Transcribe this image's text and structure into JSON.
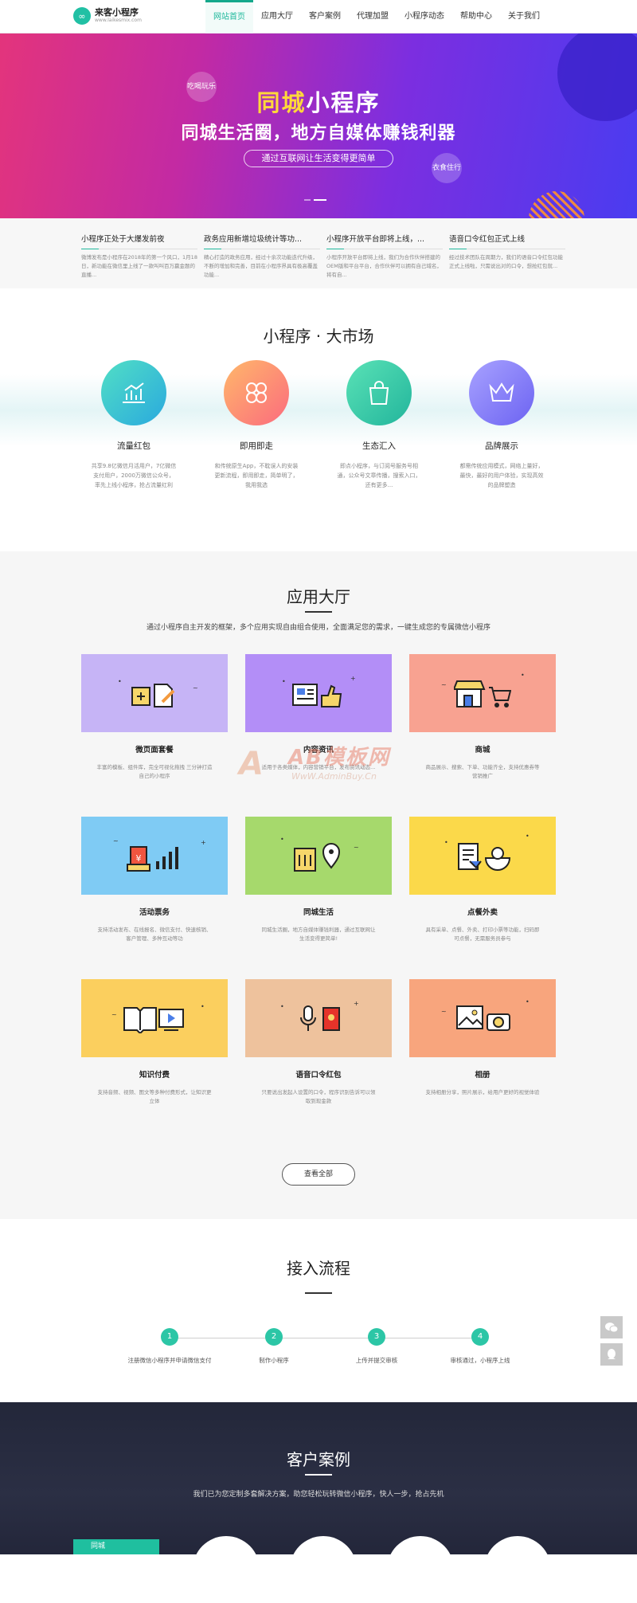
{
  "header": {
    "logo_name": "来客小程序",
    "logo_url": "www.laikesmix.com",
    "nav": [
      "网站首页",
      "应用大厅",
      "客户案例",
      "代理加盟",
      "小程序动态",
      "帮助中心",
      "关于我们"
    ]
  },
  "banner": {
    "title_hl": "同城",
    "title_rest": "小程序",
    "subtitle": "同城生活圈，地方自媒体赚钱利器",
    "pill": "通过互联网让生活变得更简单",
    "bubble_left": "吃喝玩乐",
    "bubble_right": "衣食住行"
  },
  "news": [
    {
      "title": "小程序正处于大爆发前夜",
      "text": "微博发布是小程序在2018年的第一个风口，1月18日，新功能在微信里上线了一款叫叫百万赢金题的直播..."
    },
    {
      "title": "政务应用新增垃圾统计等功...",
      "text": "精心打造的政务应用，经过十余次功能迭代升级，不断的增加和完善，目前在小程序界具有极高覆盖功能..."
    },
    {
      "title": "小程序开放平台即将上线，...",
      "text": "小程序开放平台即将上线，我们为合作伙伴搭建的OEM版和平台平台，合作伙伴可以拥有自己域名，将有自..."
    },
    {
      "title": "语音口令红包正式上线",
      "text": "经过技术团队在周期力，我们的语音口令红包功能正式上线啦，只需说出对的口令，想抢红包就..."
    }
  ],
  "market": {
    "title": "小程序 · 大市场",
    "items": [
      {
        "title": "流量红包",
        "text": "共享9.8亿微信月活用户，7亿微信支付用户，2000万微信公众号，率先上线小程序，抢占流量红利"
      },
      {
        "title": "即用即走",
        "text": "和传统原生App，不耽误人的安装更新流程，即用即走，简单明了，我用我选"
      },
      {
        "title": "生态汇入",
        "text": "即点小程序，与订阅号服务号相通，公众号文章传播，搜索入口，还有更多..."
      },
      {
        "title": "品牌展示",
        "text": "都需传统应用模式，网络上量好，最快，最好的用户体验，实现高效的品牌塑造"
      }
    ]
  },
  "apps": {
    "title": "应用大厅",
    "desc": "通过小程序自主开发的框架，多个应用实现自由组合使用，全面满足您的需求，一键生成您的专属微信小程序",
    "items": [
      {
        "title": "微页面套餐",
        "text": "丰富的模板、组件库，完全可视化拖拽 三分钟打造自己的小程序",
        "color": "#c6b4f6"
      },
      {
        "title": "内容资讯",
        "text": "适用于各类媒体，内容营销平台，发布资讯动态...",
        "color": "#b38ef7"
      },
      {
        "title": "商城",
        "text": "商品展示、搜索、下单、功能齐全，支持优惠券等营销推广",
        "color": "#f8a291"
      },
      {
        "title": "活动票务",
        "text": "支持活动发布、在线报名、微信支付、快速核销、客户管理、多种互动等功",
        "color": "#7fcbf4"
      },
      {
        "title": "同城生活",
        "text": "同城生活圈，地方自媒体赚钱利器，通过互联网让生活变得更简单!",
        "color": "#a6d96c"
      },
      {
        "title": "点餐外卖",
        "text": "具有采单、点餐、外卖、打印小票等功能，扫码即可点餐，无需服务员参与",
        "color": "#fbd94a"
      },
      {
        "title": "知识付费",
        "text": "支持音频、视频、图文等多种付费形式，让知识更立体",
        "color": "#fbcf5e"
      },
      {
        "title": "语音口令红包",
        "text": "只要说出发起人设置的口令，程序识别告诉可以领取到现金款",
        "color": "#eec29d"
      },
      {
        "title": "相册",
        "text": "支持相册分享，照片展示，给用户更好的视觉体验",
        "color": "#f8a57d"
      }
    ],
    "view_all": "查看全部"
  },
  "watermark": {
    "big": "AB模板网",
    "small": "WwW.AdminBuy.Cn"
  },
  "process": {
    "title": "接入流程",
    "steps": [
      {
        "num": "1",
        "label": "注册微信小程序并申请微信支付"
      },
      {
        "num": "2",
        "label": "制作小程序"
      },
      {
        "num": "3",
        "label": "上传并提交审核"
      },
      {
        "num": "4",
        "label": "审核通过，小程序上线"
      }
    ]
  },
  "cases": {
    "title": "客户案例",
    "desc": "我们已为您定制多套解决方案，助您轻松玩转微信小程序，快人一步，抢占先机",
    "tab": "同城"
  }
}
